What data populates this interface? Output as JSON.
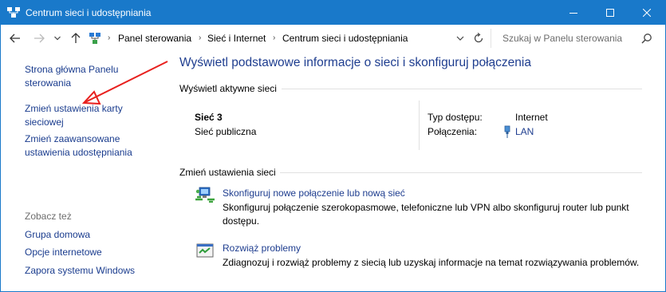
{
  "window": {
    "title": "Centrum sieci i udostępniania"
  },
  "titlebar": {
    "minimize_label": "Minimize",
    "maximize_label": "Maximize",
    "close_label": "Close"
  },
  "address": {
    "crumbs": [
      "Panel sterowania",
      "Sieć i Internet",
      "Centrum sieci i udostępniania"
    ],
    "search_placeholder": "Szukaj w Panelu sterowania"
  },
  "sidebar": {
    "items": [
      {
        "label_line1": "Strona główna Panelu",
        "label_line2": "sterowania"
      },
      {
        "label_line1": "Zmień ustawienia karty",
        "label_line2": "sieciowej"
      },
      {
        "label_line1": "Zmień zaawansowane",
        "label_line2": "ustawienia udostępniania"
      }
    ],
    "see_also_header": "Zobacz też",
    "see_also": [
      "Grupa domowa",
      "Opcje internetowe",
      "Zapora systemu Windows"
    ]
  },
  "main": {
    "title": "Wyświetl podstawowe informacje o sieci i skonfiguruj połączenia",
    "active_networks_header": "Wyświetl aktywne sieci",
    "network": {
      "name": "Sieć  3",
      "type": "Sieć publiczna",
      "access_label": "Typ dostępu:",
      "access_value": "Internet",
      "connections_label": "Połączenia:",
      "connections_value": "LAN"
    },
    "change_settings_header": "Zmień ustawienia sieci",
    "tasks": [
      {
        "link": "Skonfiguruj nowe połączenie lub nową sieć",
        "desc_line1": "Skonfiguruj połączenie szerokopasmowe, telefoniczne lub VPN albo skonfiguruj router lub punkt",
        "desc_line2": "dostępu."
      },
      {
        "link": "Rozwiąż problemy",
        "desc_line1": "Zdiagnozuj i rozwiąż problemy z siecią lub uzyskaj informacje na temat rozwiązywania problemów."
      }
    ]
  },
  "colors": {
    "titlebar": "#1979ca",
    "link": "#1e3d8f",
    "annotation_arrow": "#e8201e"
  },
  "icons": [
    "network-center-icon",
    "back-arrow-icon",
    "forward-arrow-icon",
    "up-arrow-icon",
    "refresh-icon",
    "search-icon",
    "lan-plug-icon",
    "new-connection-icon",
    "troubleshoot-icon"
  ]
}
